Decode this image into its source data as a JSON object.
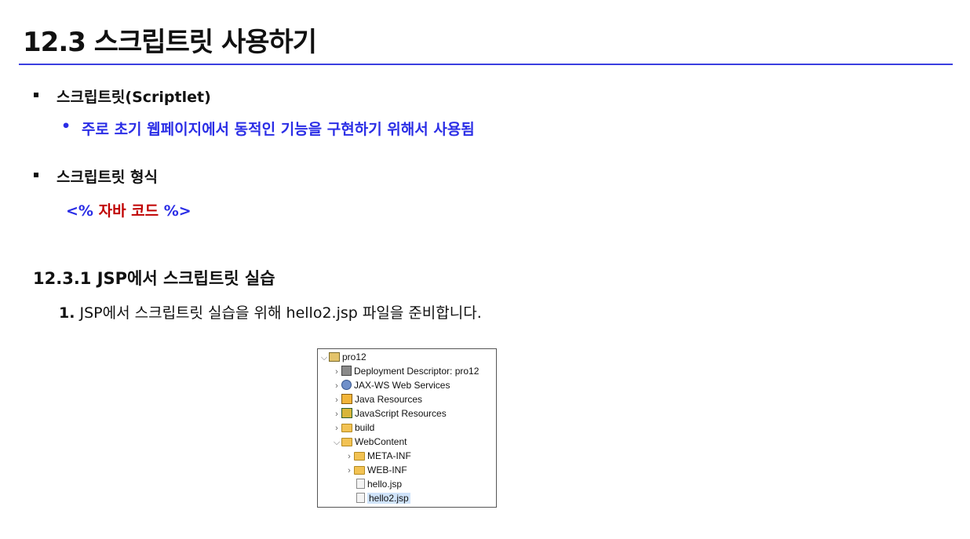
{
  "slide": {
    "title": "12.3 스크립트릿 사용하기",
    "bullets": [
      {
        "text": "스크립트릿(Scriptlet)",
        "sub": "주로 초기 웹페이지에서 동적인 기능을 구현하기 위해서 사용됨"
      },
      {
        "text": "스크립트릿 형식"
      }
    ],
    "code_open": "<%",
    "code_body": " 자바 코드 ",
    "code_close": "%>",
    "subheading": "12.3.1 JSP에서 스크립트릿 실습",
    "step_number": "1.",
    "step_text": " JSP에서 스크립트릿 실습을 위해 hello2.jsp 파일을 준비합니다."
  },
  "tree": {
    "items": [
      {
        "label": "pro12",
        "icon": "project-icon",
        "expanded": true
      },
      {
        "label": "Deployment Descriptor: pro12",
        "icon": "deployment-descriptor-icon"
      },
      {
        "label": "JAX-WS Web Services",
        "icon": "web-services-icon"
      },
      {
        "label": "Java Resources",
        "icon": "java-resources-icon"
      },
      {
        "label": "JavaScript Resources",
        "icon": "javascript-resources-icon"
      },
      {
        "label": "build",
        "icon": "folder-icon"
      },
      {
        "label": "WebContent",
        "icon": "folder-icon",
        "expanded": true
      },
      {
        "label": "META-INF",
        "icon": "folder-icon"
      },
      {
        "label": "WEB-INF",
        "icon": "folder-icon"
      },
      {
        "label": "hello.jsp",
        "icon": "jsp-file-icon"
      },
      {
        "label": "hello2.jsp",
        "icon": "jsp-file-icon",
        "selected": true
      }
    ]
  },
  "colors": {
    "accent": "#2b2ee6",
    "rule": "#3b3fe0",
    "code": "#c00000"
  }
}
